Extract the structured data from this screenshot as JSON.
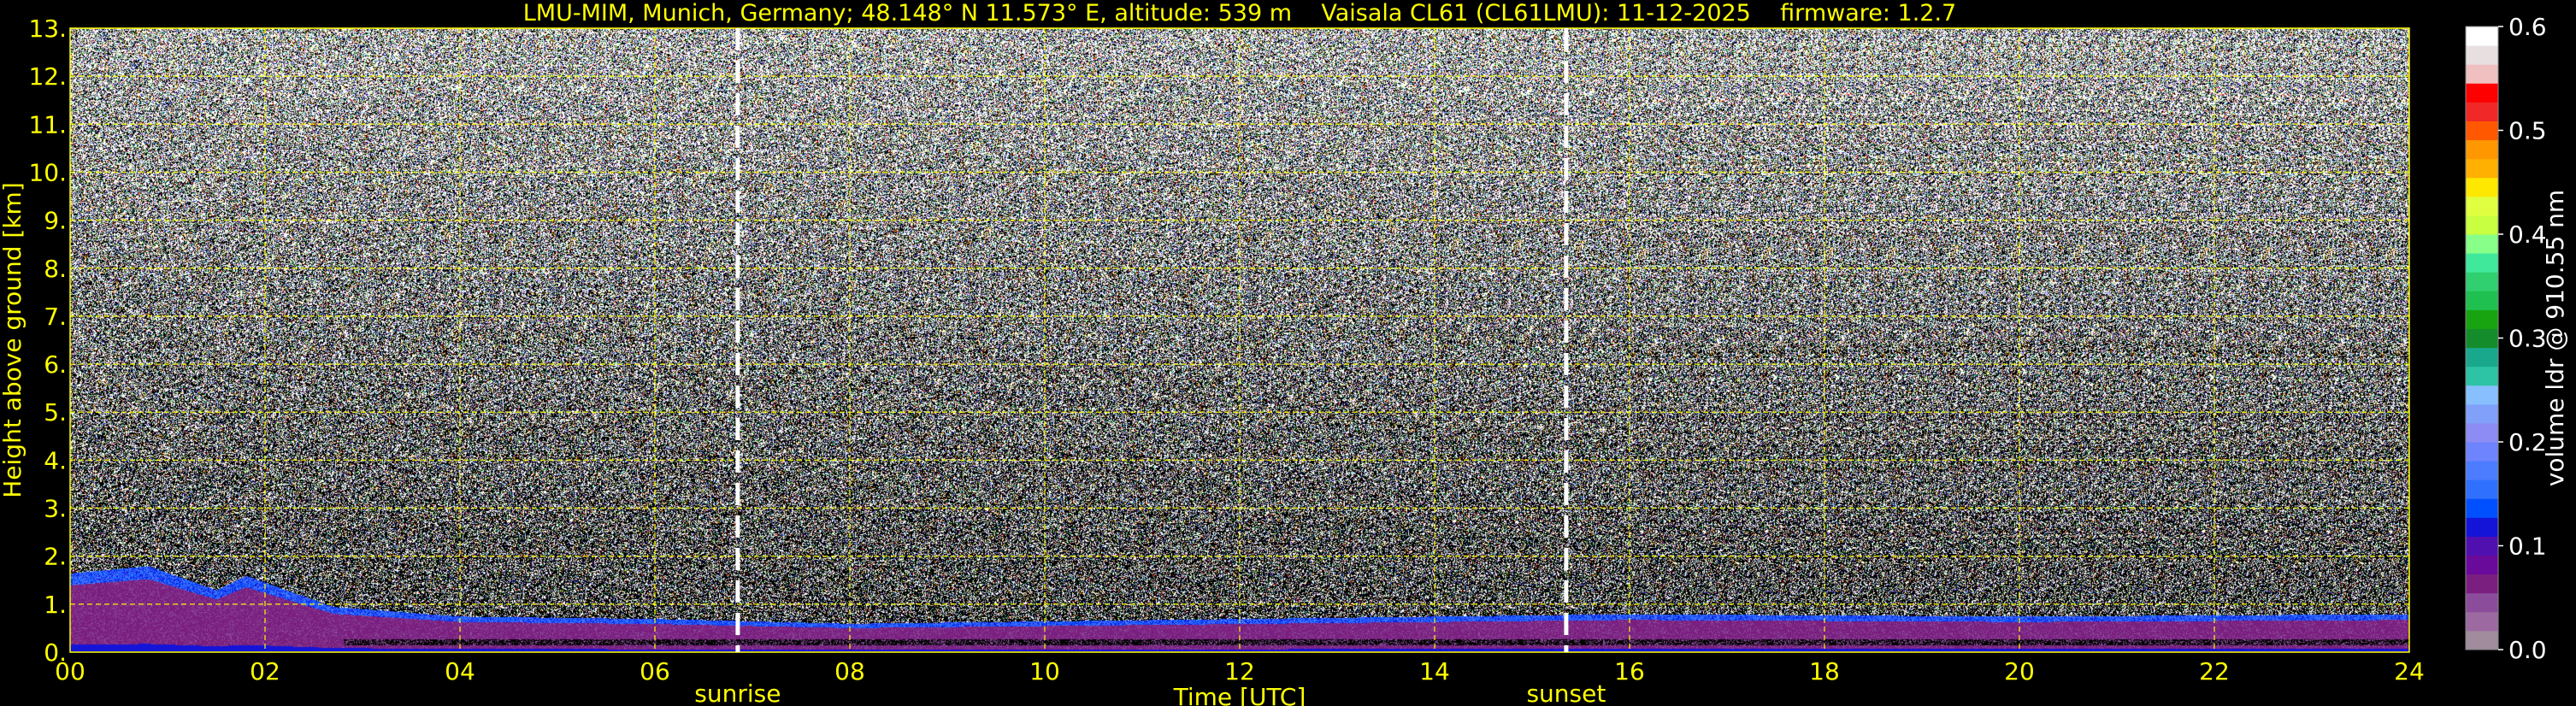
{
  "title": "LMU-MIM, Munich, Germany; 48.148° N 11.573° E, altitude: 539 m    Vaisala CL61 (CL61LMU): 11-12-2025    firmware: 1.2.7",
  "chart_data": {
    "type": "heatmap",
    "title": "LMU-MIM, Munich, Germany; 48.148° N 11.573° E, altitude: 539 m    Vaisala CL61 (CL61LMU): 11-12-2025    firmware: 1.2.7",
    "xlabel": "Time [UTC]",
    "ylabel": "Height above ground [km]",
    "xlim": [
      0,
      24
    ],
    "ylim": [
      0,
      13
    ],
    "x_ticks": [
      "00",
      "02",
      "04",
      "06",
      "08",
      "10",
      "12",
      "14",
      "16",
      "18",
      "20",
      "22",
      "24"
    ],
    "y_ticks": [
      "0.",
      "1.",
      "2.",
      "3.",
      "4.",
      "5.",
      "6.",
      "7.",
      "8.",
      "9.",
      "10.",
      "11.",
      "12.",
      "13."
    ],
    "grid": true,
    "annotations": [
      {
        "label": "sunrise",
        "time": 6.85
      },
      {
        "label": "sunset",
        "time": 15.35
      }
    ],
    "colorbar": {
      "label": "volume ldr @ 910.55 nm",
      "range": [
        0,
        0.6
      ],
      "ticks": [
        "0.0",
        "0.1",
        "0.2",
        "0.3",
        "0.4",
        "0.5",
        "0.6"
      ],
      "colors": [
        "#a08c9c",
        "#9c6aa0",
        "#8c4c9c",
        "#7a1f7f",
        "#6a0a9a",
        "#5010b0",
        "#1414d8",
        "#0050ff",
        "#3070ff",
        "#4c7cff",
        "#6e84ff",
        "#8c8cf4",
        "#80a0fa",
        "#88c0ff",
        "#2cc4a4",
        "#1aa88c",
        "#148c2c",
        "#18a410",
        "#20c050",
        "#30d070",
        "#40e89c",
        "#88ff88",
        "#c8ff40",
        "#e0ff40",
        "#ffe800",
        "#ffb000",
        "#ff9800",
        "#ff5800",
        "#f02828",
        "#ff0000",
        "#f0c0c0",
        "#e8e0e0",
        "#ffffff"
      ]
    },
    "aerosol_layer_top_km": [
      {
        "time": 0,
        "top": 1.65
      },
      {
        "time": 0.8,
        "top": 1.8
      },
      {
        "time": 1.5,
        "top": 1.3
      },
      {
        "time": 1.8,
        "top": 1.6
      },
      {
        "time": 2.7,
        "top": 0.95
      },
      {
        "time": 4,
        "top": 0.75
      },
      {
        "time": 6,
        "top": 0.7
      },
      {
        "time": 8,
        "top": 0.6
      },
      {
        "time": 12,
        "top": 0.7
      },
      {
        "time": 16,
        "top": 0.8
      },
      {
        "time": 20,
        "top": 0.75
      },
      {
        "time": 24,
        "top": 0.8
      }
    ]
  }
}
